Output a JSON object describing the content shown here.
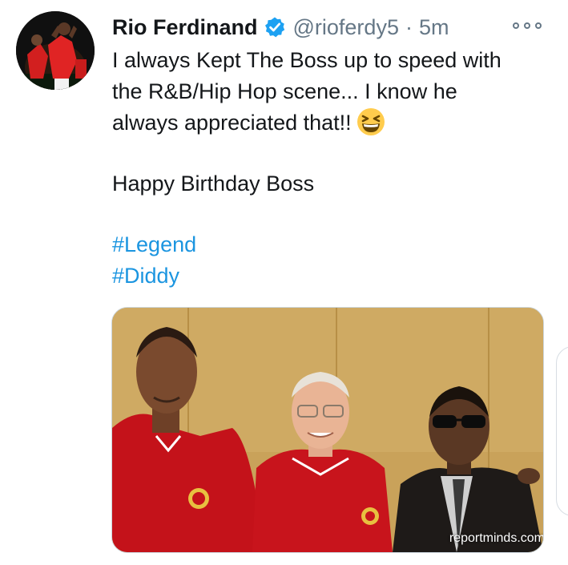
{
  "tweet": {
    "author_name": "Rio Ferdinand",
    "handle": "@rioferdy5",
    "separator": "·",
    "time": "5m",
    "text_lines": [
      "I always Kept The Boss up to speed with",
      "the R&B/Hip Hop scene... I know he",
      "always appreciated that!!"
    ],
    "birthday_line": "Happy Birthday Boss",
    "hashtags": [
      "#Legend",
      "#Diddy"
    ],
    "media_watermark": "reportminds.com"
  },
  "icons": {
    "verified": "verified-badge-icon",
    "emoji": "grinning-squinting-face-emoji",
    "more": "more-options-icon"
  },
  "colors": {
    "text": "#14171a",
    "secondary": "#657786",
    "link": "#1b95e0",
    "verified": "#1da1f2"
  }
}
